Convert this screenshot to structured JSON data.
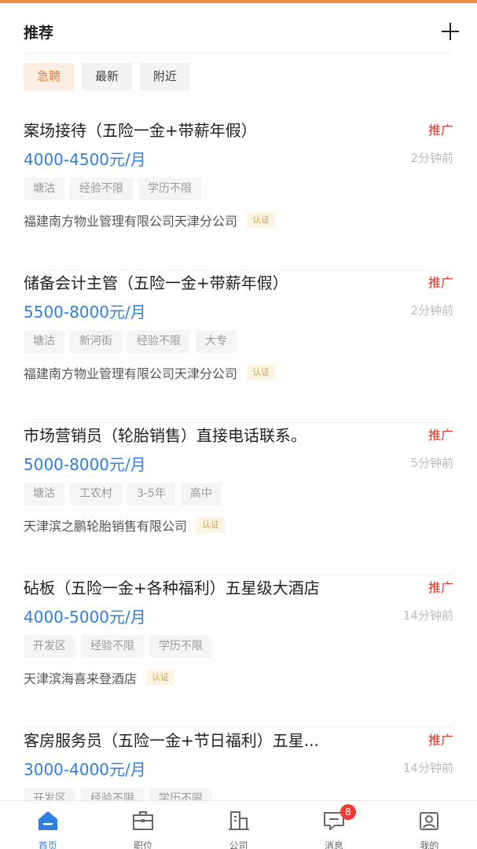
{
  "header": {
    "title": "推荐"
  },
  "filters": [
    {
      "label": "急聘",
      "active": true
    },
    {
      "label": "最新",
      "active": false
    },
    {
      "label": "附近",
      "active": false
    }
  ],
  "jobs": [
    {
      "title": "案场接待（五险一金+带薪年假）",
      "promo": "推广",
      "salary": "4000-4500元/月",
      "time": "2分钟前",
      "tags": [
        "塘沽",
        "经验不限",
        "学历不限"
      ],
      "company": "福建南方物业管理有限公司天津分公司",
      "verified": "认证"
    },
    {
      "title": "储备会计主管（五险一金+带薪年假）",
      "promo": "推广",
      "salary": "5500-8000元/月",
      "time": "2分钟前",
      "tags": [
        "塘沽",
        "新河街",
        "经验不限",
        "大专"
      ],
      "company": "福建南方物业管理有限公司天津分公司",
      "verified": "认证"
    },
    {
      "title": "市场营销员（轮胎销售）直接电话联系。",
      "promo": "推广",
      "salary": "5000-8000元/月",
      "time": "5分钟前",
      "tags": [
        "塘沽",
        "工农村",
        "3-5年",
        "高中"
      ],
      "company": "天津滨之鹏轮胎销售有限公司",
      "verified": "认证"
    },
    {
      "title": "砧板（五险一金+各种福利）五星级大酒店",
      "promo": "推广",
      "salary": "4000-5000元/月",
      "time": "14分钟前",
      "tags": [
        "开发区",
        "经验不限",
        "学历不限"
      ],
      "company": "天津滨海喜来登酒店",
      "verified": "认证"
    },
    {
      "title": "客房服务员（五险一金+节日福利）五星...",
      "promo": "推广",
      "salary": "3000-4000元/月",
      "time": "14分钟前",
      "tags": [
        "开发区",
        "经验不限",
        "学历不限"
      ],
      "company": "",
      "verified": ""
    }
  ],
  "bottom_nav": [
    {
      "label": "首页",
      "icon": "home-icon",
      "active": true
    },
    {
      "label": "职位",
      "icon": "briefcase-icon",
      "active": false
    },
    {
      "label": "公司",
      "icon": "building-icon",
      "active": false
    },
    {
      "label": "消息",
      "icon": "message-icon",
      "active": false,
      "badge": "8"
    },
    {
      "label": "我的",
      "icon": "profile-icon",
      "active": false
    }
  ],
  "colors": {
    "accent": "#f08a3c",
    "salary": "#2f7fe0",
    "promo": "#e0352b"
  }
}
